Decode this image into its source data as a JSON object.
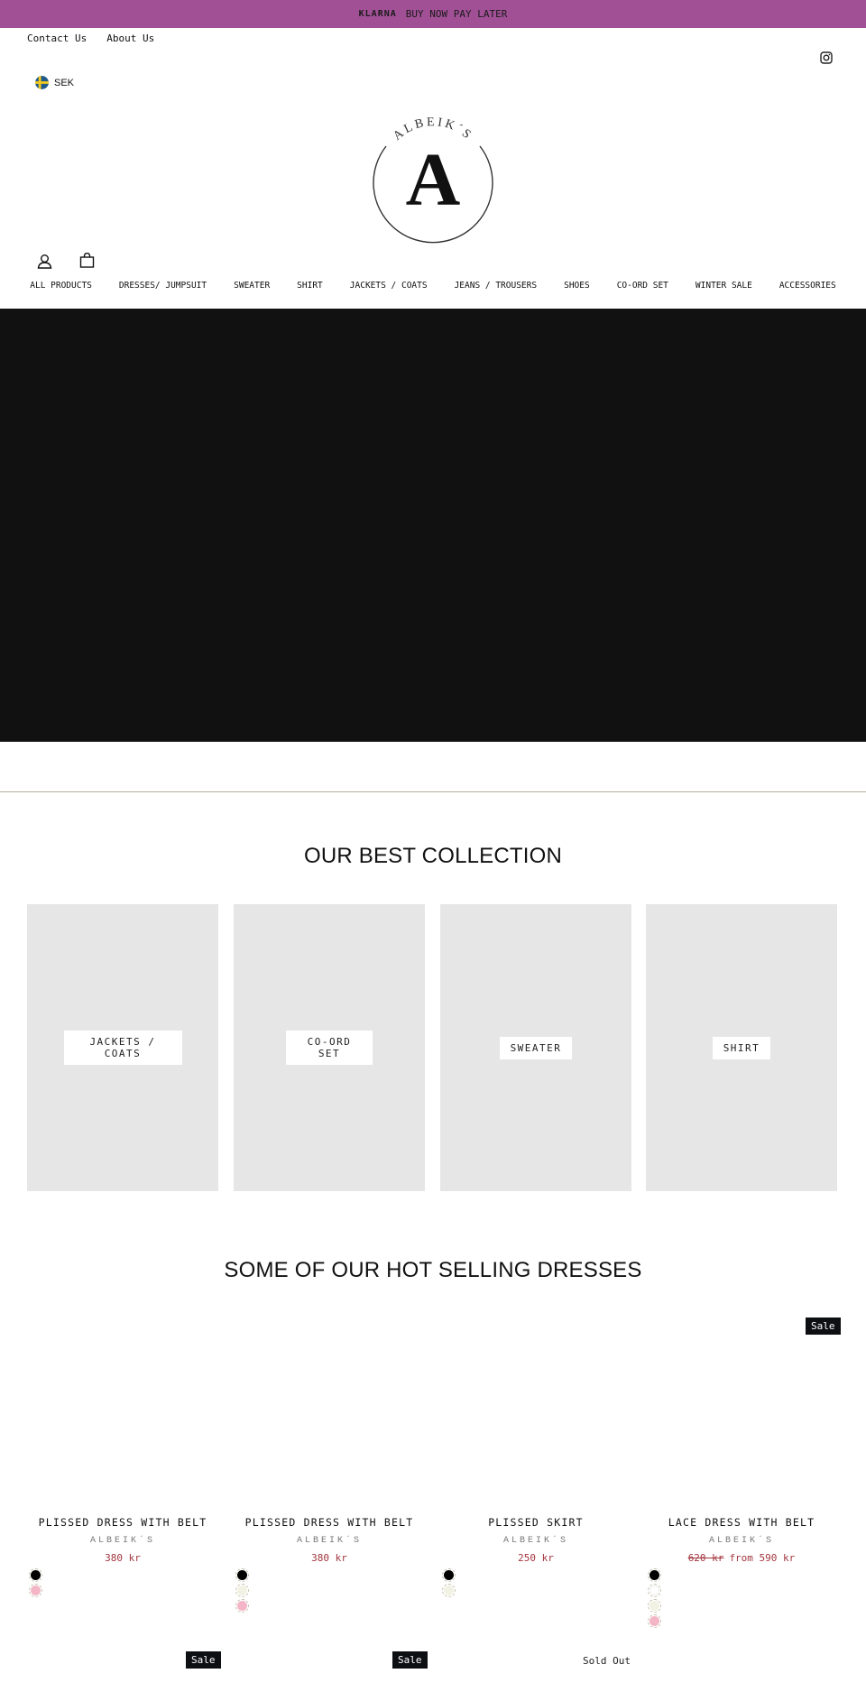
{
  "announcement": {
    "brand": "KLARNA",
    "text": "BUY NOW PAY LATER",
    "bg_color": "#a25096"
  },
  "top_links": [
    {
      "label": "Contact Us"
    },
    {
      "label": "About Us"
    }
  ],
  "social": {
    "icon": "instagram-icon"
  },
  "currency": {
    "code": "SEK",
    "icon": "sweden-flag-icon"
  },
  "logo": {
    "arc_text": "ALBEIK´S",
    "letter": "A"
  },
  "header_icons": {
    "account": "account-icon",
    "cart": "shopping-bag-icon"
  },
  "nav": {
    "items": [
      {
        "label": "ALL PRODUCTS"
      },
      {
        "label": "DRESSES/ JUMPSUIT"
      },
      {
        "label": "SWEATER"
      },
      {
        "label": "SHIRT"
      },
      {
        "label": "JACKETS / COATS"
      },
      {
        "label": "JEANS / TROUSERS"
      },
      {
        "label": "SHOES"
      },
      {
        "label": "CO-ORD SET"
      },
      {
        "label": "WINTER SALE"
      },
      {
        "label": "ACCESSORIES"
      }
    ]
  },
  "collection": {
    "title": "OUR BEST COLLECTION",
    "items": [
      {
        "label": "JACKETS / COATS"
      },
      {
        "label": "CO-ORD SET"
      },
      {
        "label": "SWEATER"
      },
      {
        "label": "SHIRT"
      }
    ]
  },
  "hot": {
    "title": "SOME OF OUR HOT SELLING DRESSES",
    "products": [
      {
        "title": "PLISSED DRESS WITH BELT",
        "vendor": "ALBEIK´S",
        "price": "380 kr",
        "compare": "",
        "badge": "",
        "swatches": [
          "#000000",
          "#f4b6c6"
        ]
      },
      {
        "title": "PLISSED DRESS WITH BELT",
        "vendor": "ALBEIK´S",
        "price": "380 kr",
        "compare": "",
        "badge": "",
        "swatches": [
          "#000000",
          "#f2f2e4",
          "#f4b6c6"
        ]
      },
      {
        "title": "PLISSED SKIRT",
        "vendor": "ALBEIK´S",
        "price": "250 kr",
        "compare": "",
        "badge": "",
        "swatches": [
          "#000000",
          "#f2f2e4"
        ]
      },
      {
        "title": "LACE DRESS WITH BELT",
        "vendor": "ALBEIK´S",
        "price": "from 590 kr",
        "compare": "620 kr",
        "badge": "Sale",
        "swatches": [
          "#000000",
          "#ffffff",
          "#f2f2e4",
          "#f4b6c6"
        ]
      }
    ],
    "next_row_badges": [
      {
        "label": "Sale"
      },
      {
        "label": "Sale"
      },
      {
        "label": "Sold Out"
      }
    ]
  }
}
